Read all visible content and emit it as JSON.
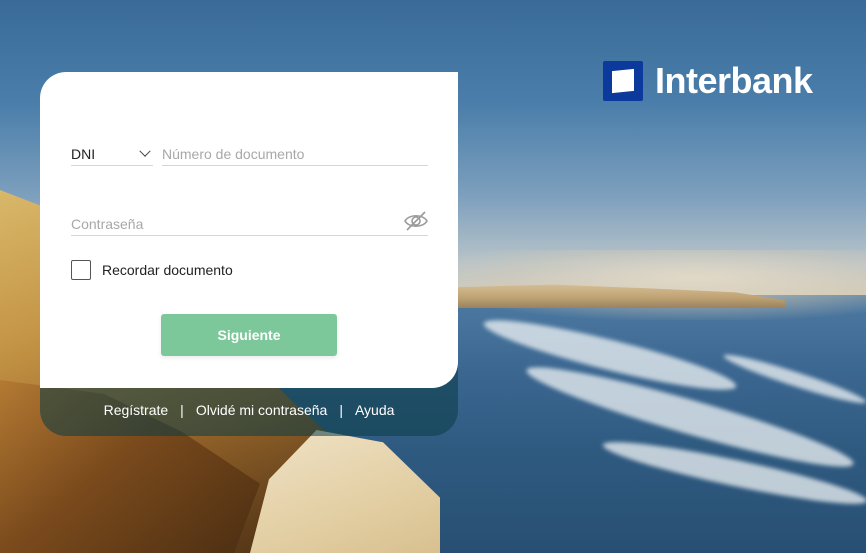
{
  "brand": {
    "name": "Interbank",
    "logo_color": "#0b3a9c"
  },
  "login": {
    "doc_type": {
      "selected": "DNI"
    },
    "doc_number": {
      "placeholder": "Número de documento",
      "value": ""
    },
    "password": {
      "placeholder": "Contraseña",
      "value": ""
    },
    "remember": {
      "label": "Recordar documento",
      "checked": false
    },
    "next_button": {
      "label": "Siguiente",
      "color": "#7dc89a"
    }
  },
  "footer": {
    "links": [
      "Regístrate",
      "Olvidé mi contraseña",
      "Ayuda"
    ],
    "separator": "|"
  },
  "icons": {
    "doc_type_chevron": "chevron-down-icon",
    "password_toggle": "eye-slash-icon"
  }
}
